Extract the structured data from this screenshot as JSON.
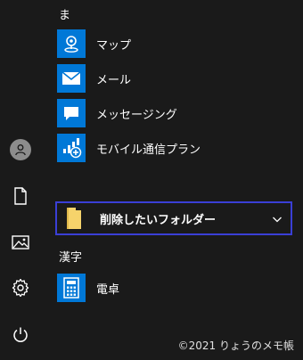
{
  "section_ma": {
    "header": "ま"
  },
  "apps": [
    {
      "label": "マップ",
      "icon": "map-icon"
    },
    {
      "label": "メール",
      "icon": "mail-icon"
    },
    {
      "label": "メッセージング",
      "icon": "message-icon"
    },
    {
      "label": "モバイル通信プラン",
      "icon": "cellular-plan-icon"
    }
  ],
  "folder": {
    "label": "削除したいフォルダー",
    "icon": "folder-icon",
    "expand_icon": "chevron-down-icon"
  },
  "section_kanji": {
    "header": "漢字"
  },
  "calculator": {
    "label": "電卓",
    "icon": "calculator-icon"
  },
  "rail": [
    "user-avatar-icon",
    "document-icon",
    "pictures-icon",
    "settings-icon",
    "power-icon"
  ],
  "footer": {
    "copyright": "©2021 りょうのメモ帳"
  },
  "colors": {
    "tile": "#0078d7",
    "background": "#1a1a1a",
    "focus_border": "#3a3fd6",
    "folder": "#f6d36b"
  }
}
